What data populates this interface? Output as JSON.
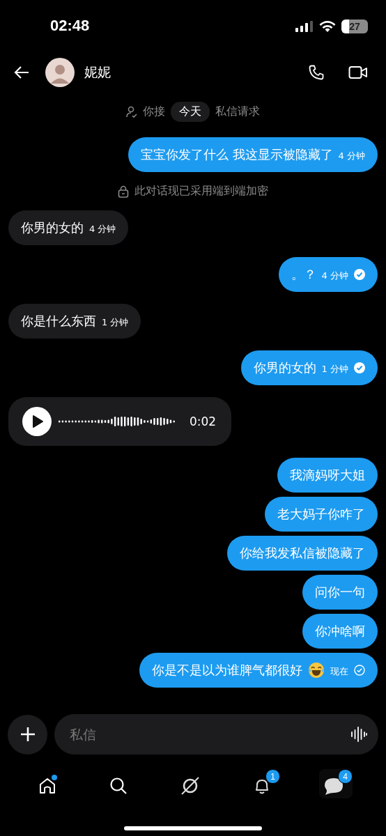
{
  "status_bar": {
    "time": "02:48",
    "battery": "27"
  },
  "header": {
    "name": "妮妮"
  },
  "messages": [
    {
      "kind": "request-notice",
      "before": "你接",
      "pill": "今天",
      "after": "私信请求"
    },
    {
      "kind": "text",
      "outgoing": true,
      "text": "宝宝你发了什么 我这显示被隐藏了",
      "time": "4 分钟"
    },
    {
      "kind": "encryption-notice",
      "text": "此对话现已采用端到端加密"
    },
    {
      "kind": "text",
      "outgoing": false,
      "text": "你男的女的",
      "time": "4 分钟"
    },
    {
      "kind": "text",
      "outgoing": true,
      "text": "。？",
      "time": "4 分钟",
      "read": true
    },
    {
      "kind": "text",
      "outgoing": false,
      "text": "你是什么东西",
      "time": "1 分钟"
    },
    {
      "kind": "text",
      "outgoing": true,
      "text": "你男的女的",
      "time": "1 分钟",
      "read": true
    },
    {
      "kind": "voice",
      "outgoing": false,
      "duration": "0:02"
    },
    {
      "kind": "text",
      "outgoing": true,
      "text": "我滴妈呀大姐"
    },
    {
      "kind": "text",
      "outgoing": true,
      "text": "老大妈子你咋了"
    },
    {
      "kind": "text",
      "outgoing": true,
      "text": "你给我发私信被隐藏了"
    },
    {
      "kind": "text",
      "outgoing": true,
      "text": "问你一句"
    },
    {
      "kind": "text",
      "outgoing": true,
      "text": "你冲啥啊"
    },
    {
      "kind": "text-with-emoji",
      "outgoing": true,
      "text": "你是不是以为谁脾气都很好",
      "time": "现在",
      "read": false
    }
  ],
  "composer": {
    "placeholder": "私信"
  },
  "nav": [
    {
      "kind": "home",
      "selected": false,
      "dot": true
    },
    {
      "kind": "search",
      "selected": false
    },
    {
      "kind": "grok",
      "selected": false
    },
    {
      "kind": "notifications",
      "selected": false,
      "badge": "1"
    },
    {
      "kind": "messages",
      "selected": true,
      "badge": "4"
    }
  ]
}
